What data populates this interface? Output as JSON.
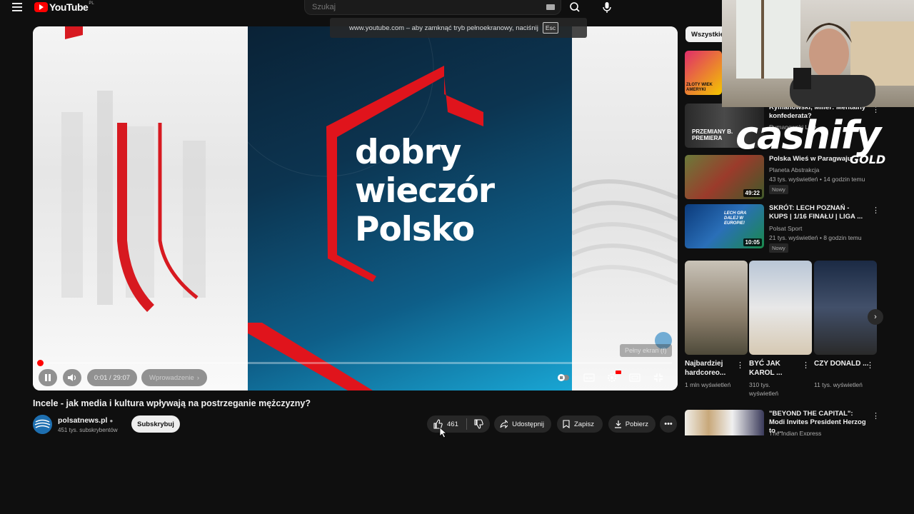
{
  "header": {
    "logo_text": "YouTube",
    "logo_region": "PL",
    "search_placeholder": "Szukaj"
  },
  "fullscreen_hint": {
    "text": "www.youtube.com – aby zamknąć tryb pełnoekranowy, naciśnij",
    "key": "Esc"
  },
  "player": {
    "frame_title": [
      "dobry",
      "wieczór",
      "Polsko"
    ],
    "time": "0:01 / 29:07",
    "chapter": "Wprowadzenie",
    "fullscreen_tooltip": "Pełny ekran (f)",
    "progress_fraction": 0.0006
  },
  "video": {
    "title": "Incele - jak media i kultura wpływają na postrzeganie mężczyzny?",
    "channel": "polsatnews.pl",
    "subscribers": "451 tys. subskrybentów",
    "subscribe_label": "Subskrybuj",
    "likes": "461",
    "share_label": "Udostępnij",
    "save_label": "Zapisz",
    "download_label": "Pobierz"
  },
  "sidebar": {
    "chip": "Wszystkie",
    "recs": [
      {
        "title": "",
        "channel": "",
        "meta": "",
        "duration": "",
        "thumb_text": "ZŁOTY WIEK AMERYKI"
      },
      {
        "title": "Rymanowski, Miller: Mentalny konfederata?",
        "channel": "Rymanowski Live",
        "meta": "",
        "duration": "",
        "thumb_text": "PRZEMIANY B. PREMIERA"
      },
      {
        "title": "Polska Wieś w Paragwaju",
        "channel": "Planeta Abstrakcja",
        "meta": "43 tys. wyświetleń • 14 godzin temu",
        "badge": "Nowy",
        "duration": "49:22",
        "thumb_text": ""
      },
      {
        "title": "SKRÓT: LECH POZNAŃ - KUPS | 1/16 FINAŁU | LIGA ...",
        "channel": "Polsat Sport",
        "meta": "21 tys. wyświetleń • 8 godzin temu",
        "badge": "Nowy",
        "duration": "10:05",
        "thumb_text": "LECH GRA DALEJ W EUROPIE!"
      }
    ],
    "shorts": [
      {
        "title": "Najbardziej hardcoreo...",
        "views": "1 mln wyświetleń"
      },
      {
        "title": "BYĆ JAK KAROL ...",
        "views": "310 tys. wyświetleń"
      },
      {
        "title": "CZY DONALD ...",
        "views": "11 tys. wyświetleń"
      }
    ],
    "last_rec": {
      "title": "\"BEYOND THE CAPITAL\": Modi Invites President Herzog to ...",
      "channel": "The Indian Express"
    }
  },
  "overlay": {
    "brand": "cashify",
    "brand_sub": "GOLD"
  }
}
